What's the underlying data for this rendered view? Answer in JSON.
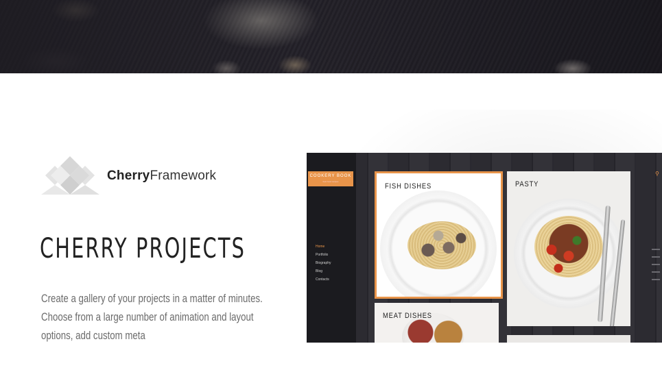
{
  "brand": {
    "name_bold": "Cherry",
    "name_light": "Framework"
  },
  "main": {
    "heading": "CHERRY PROJECTS",
    "description": "Create a gallery of your projects in a matter of minutes. Choose from a large number of animation and layout options, add custom meta"
  },
  "preview": {
    "sidebar": {
      "logo_title": "COOKERY BOOK",
      "logo_subtitle": "best food recipes",
      "menu": [
        "Home",
        "Portfolio",
        "Biography",
        "Blog",
        "Contacts"
      ]
    },
    "cards": [
      "FISH DISHES",
      "PASTY",
      "MEAT DISHES"
    ],
    "search_icon": "search-icon"
  },
  "colors": {
    "accent": "#e8944a",
    "text_dark": "#222222",
    "text_muted": "#6b6b6b"
  }
}
